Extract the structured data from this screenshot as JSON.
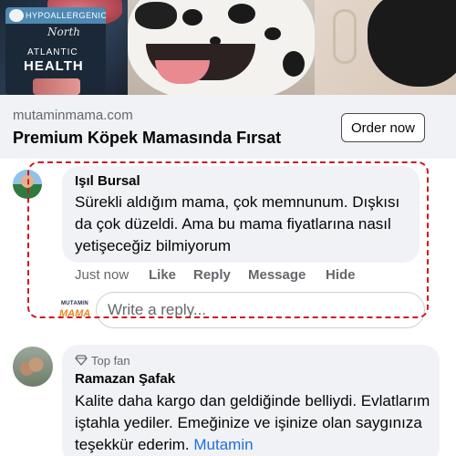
{
  "ad": {
    "image": {
      "pack_brand_top": "HYPOALLERGENIC",
      "pack_script": "North",
      "pack_line1": "ATLANTIC",
      "pack_line2": "HEALTH"
    },
    "link": {
      "domain": "mutaminmama.com",
      "title": "Premium Köpek Mamasında Fırsat",
      "cta_label": "Order now"
    }
  },
  "comments": [
    {
      "author": "Işıl Bursal",
      "text": "Sürekli aldığım mama, çok memnunum. Dışkısı da çok düzeldi. Ama bu mama fiyatlarına nasıl yetişeceğiz bilmiyorum",
      "timestamp": "Just now",
      "actions": {
        "like": "Like",
        "reply": "Reply",
        "message": "Message",
        "hide": "Hide"
      },
      "highlighted": true,
      "highlight_color": "#d01820"
    },
    {
      "badge": "Top fan",
      "badge_icon": "diamond-icon",
      "author": "Ramazan Şafak",
      "text": "Kalite daha kargo dan geldiğinde belliydi. Evlatlarım iştahla yediler. Emeğinize ve işinize olan saygınıza teşekkür ederim. ",
      "mention": "Mutamin"
    }
  ],
  "reply_box": {
    "placeholder": "Write a reply...",
    "page_avatar_top": "MUTAMIN",
    "page_avatar_bottom": "MAMA"
  },
  "colors": {
    "link_blue": "#216fdb",
    "secondary_text": "#65676b",
    "bubble_bg": "#f0f2f5",
    "brand_orange": "#e8892a"
  }
}
